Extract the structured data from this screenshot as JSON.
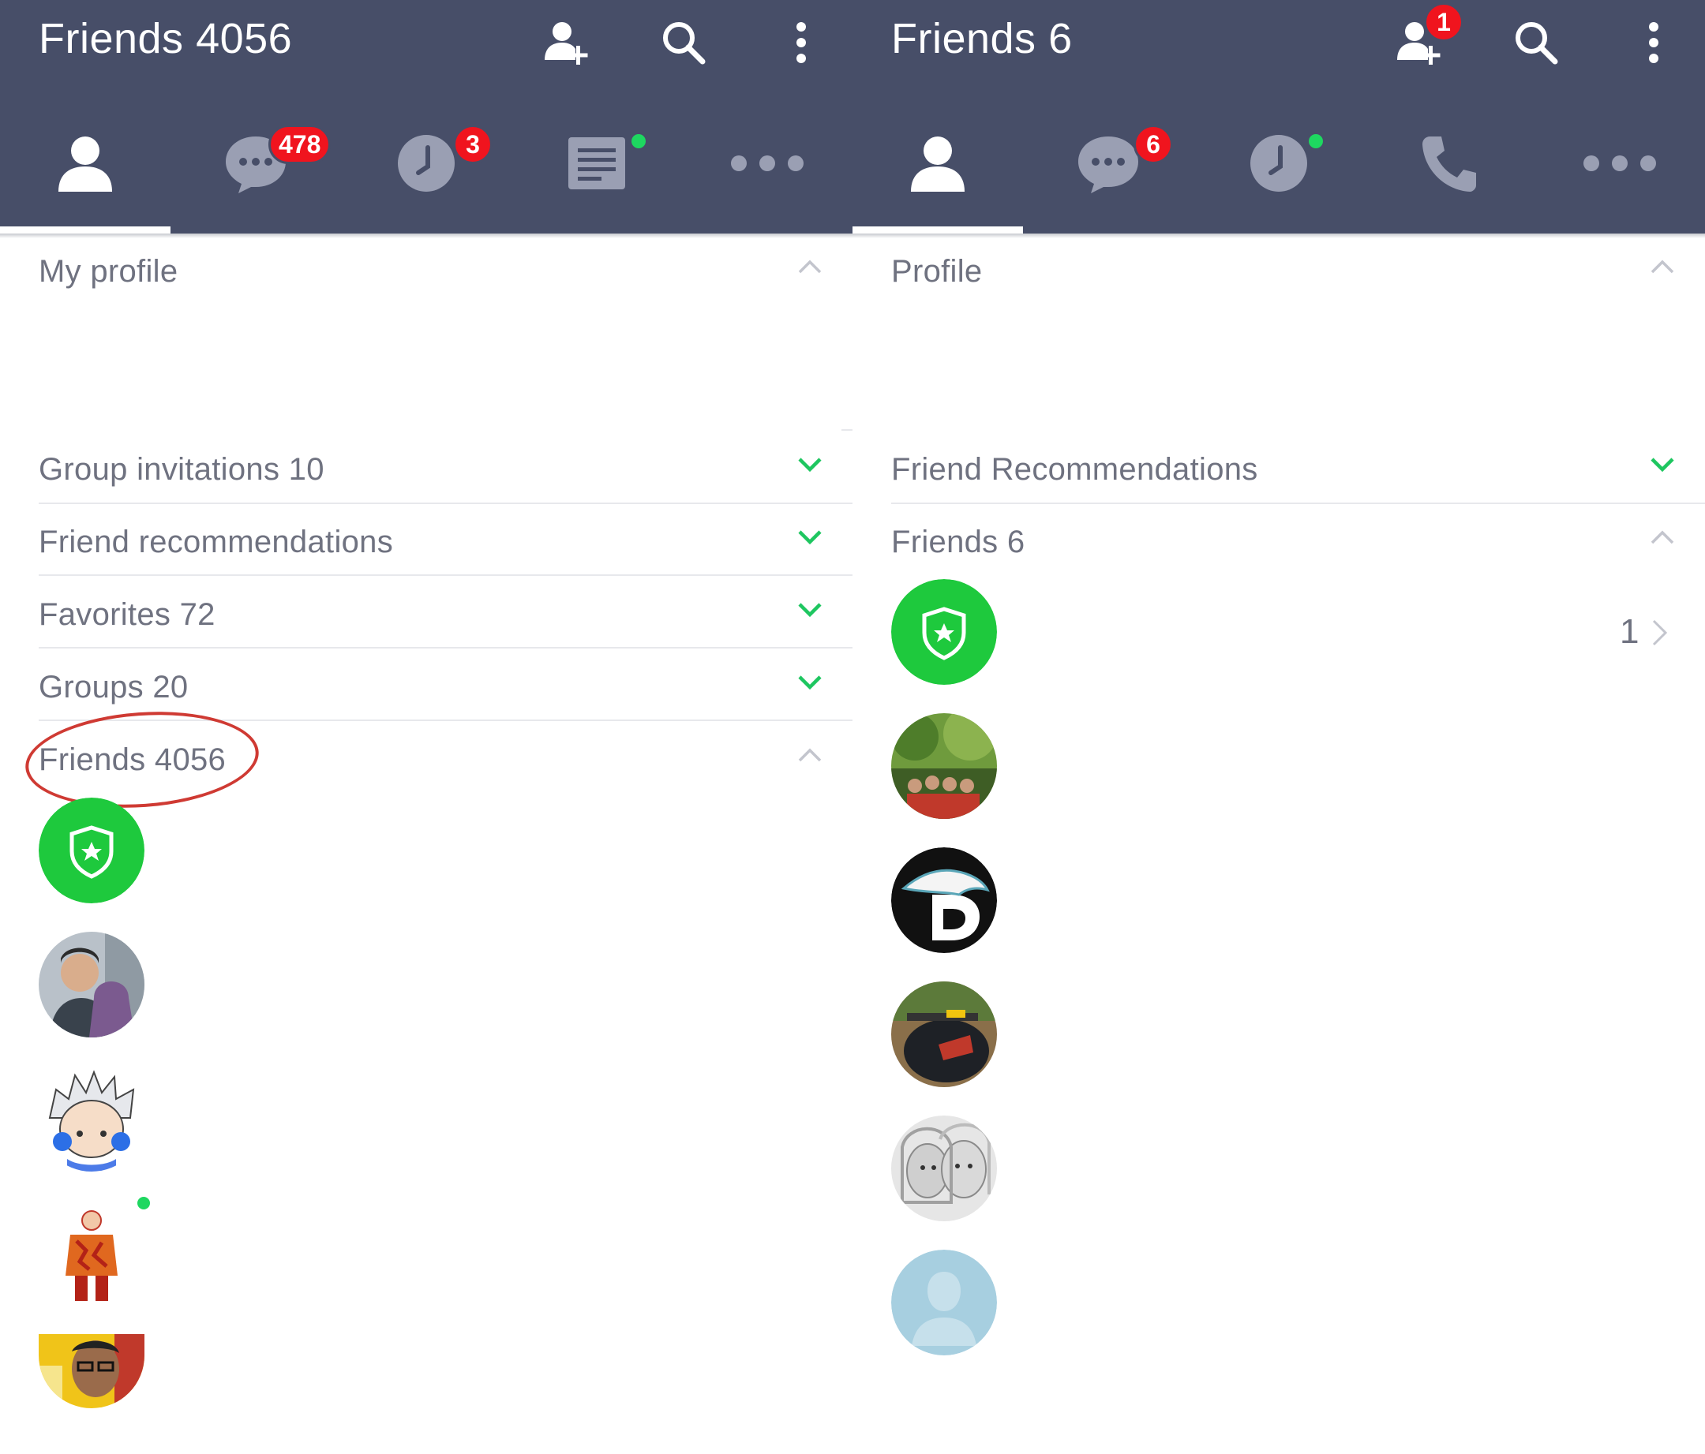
{
  "left": {
    "title": "Friends 4056",
    "tabs": {
      "chats_badge": "478",
      "timeline_badge": "3"
    },
    "sections": {
      "my_profile": "My profile",
      "group_invitations": "Group invitations 10",
      "friend_recommendations": "Friend recommendations",
      "favorites": "Favorites 72",
      "groups": "Groups 20",
      "friends": "Friends 4056"
    }
  },
  "right": {
    "title": "Friends 6",
    "addfriend_badge": "1",
    "tabs": {
      "chats_badge": "6"
    },
    "sections": {
      "profile": "Profile",
      "friend_recommendations": "Friend Recommendations",
      "friends": "Friends 6"
    },
    "official_count": "1"
  },
  "icons": {
    "add_friend": "add-friend-icon",
    "search": "search-icon",
    "menu": "more-vertical-icon",
    "friends_tab": "person-icon",
    "chats_tab": "chat-bubble-icon",
    "timeline_tab": "clock-icon",
    "news_tab": "news-icon",
    "calls_tab": "phone-icon",
    "more_tab": "more-horizontal-icon"
  },
  "colors": {
    "header": "#474e68",
    "badge": "#f0141e",
    "accent_green": "#1ed760",
    "text_gray": "#6f7280",
    "annotation_red": "#cf3a33"
  }
}
